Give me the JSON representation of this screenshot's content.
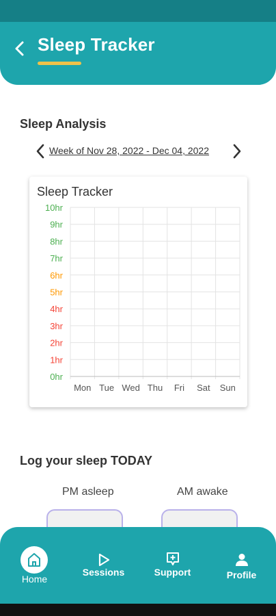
{
  "header": {
    "title": "Sleep Tracker"
  },
  "analysis": {
    "title": "Sleep Analysis",
    "week_label": "Week of Nov 28, 2022 - Dec 04, 2022"
  },
  "chart_data": {
    "type": "bar",
    "title": "Sleep Tracker",
    "categories": [
      "Mon",
      "Tue",
      "Wed",
      "Thu",
      "Fri",
      "Sat",
      "Sun"
    ],
    "values": [
      0,
      0,
      0,
      0,
      0,
      0,
      0
    ],
    "ylim": [
      0,
      10
    ],
    "y_ticks": [
      {
        "label": "0hr",
        "color": "#4caf50"
      },
      {
        "label": "1hr",
        "color": "#f44336"
      },
      {
        "label": "2hr",
        "color": "#f44336"
      },
      {
        "label": "3hr",
        "color": "#f44336"
      },
      {
        "label": "4hr",
        "color": "#f44336"
      },
      {
        "label": "5hr",
        "color": "#ff9800"
      },
      {
        "label": "6hr",
        "color": "#ff9800"
      },
      {
        "label": "7hr",
        "color": "#4caf50"
      },
      {
        "label": "8hr",
        "color": "#4caf50"
      },
      {
        "label": "9hr",
        "color": "#4caf50"
      },
      {
        "label": "10hr",
        "color": "#4caf50"
      }
    ],
    "grid": true
  },
  "log": {
    "title": "Log your sleep TODAY",
    "pm_label": "PM asleep",
    "am_label": "AM awake"
  },
  "nav": {
    "home": "Home",
    "sessions": "Sessions",
    "support": "Support",
    "profile": "Profile"
  },
  "colors": {
    "primary": "#1ea5ac",
    "status_bar": "#157f86",
    "accent": "#efc24a",
    "input_border": "#b9b1ea"
  }
}
